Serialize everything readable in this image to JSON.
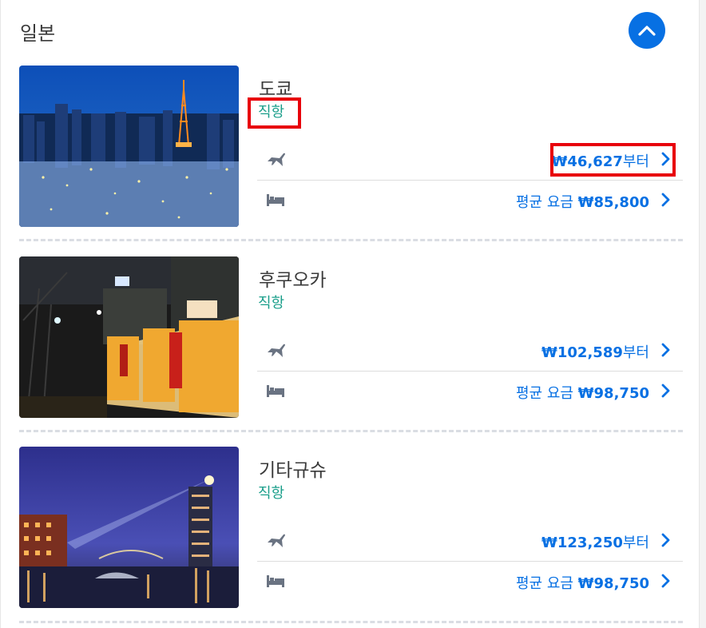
{
  "section": {
    "title": "일본"
  },
  "destinations": [
    {
      "city": "도쿄",
      "tag": "직항",
      "flight_price": "₩46,627",
      "flight_suffix": "부터",
      "hotel_prefix": "평균 요금 ",
      "hotel_price": "₩85,800"
    },
    {
      "city": "후쿠오카",
      "tag": "직항",
      "flight_price": "₩102,589",
      "flight_suffix": "부터",
      "hotel_prefix": "평균 요금 ",
      "hotel_price": "₩98,750"
    },
    {
      "city": "기타규슈",
      "tag": "직항",
      "flight_price": "₩123,250",
      "flight_suffix": "부터",
      "hotel_prefix": "평균 요금 ",
      "hotel_price": "₩98,750"
    }
  ],
  "colors": {
    "accent": "#0770e3",
    "direct": "#1a9e8a",
    "highlight": "#e8000b"
  },
  "icons": {
    "collapse": "chevron-up-icon",
    "flight": "airplane-icon",
    "hotel": "bed-icon",
    "row_arrow": "chevron-right-icon"
  }
}
